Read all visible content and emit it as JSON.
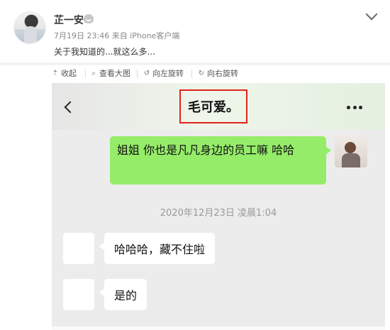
{
  "post": {
    "username": "芷一安",
    "meta": "7月19日 23:46 来自 iPhone客户端",
    "text": "关于我知道的...就这么多..."
  },
  "toolbar": {
    "collapse": "收起",
    "view_large": "查看大图",
    "rotate_left": "向左旋转",
    "rotate_right": "向右旋转"
  },
  "chat": {
    "title": "毛可爱。",
    "outgoing_message": "姐姐 你也是凡凡身边的员工嘛 哈哈",
    "timestamp": "2020年12月23日 凌晨1:04",
    "incoming": [
      "哈哈哈，藏不住啦",
      "是的"
    ]
  },
  "colors": {
    "outgoing_bubble": "#95ec69",
    "highlight_box": "#e0251b",
    "chat_background": "#ececec"
  }
}
